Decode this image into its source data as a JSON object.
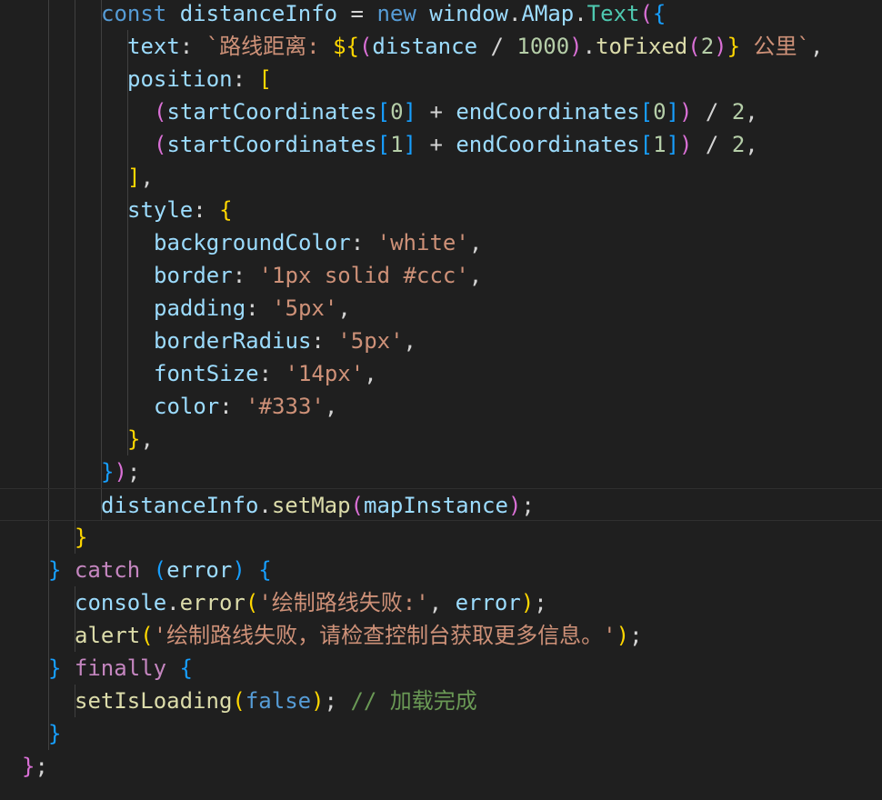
{
  "editor": {
    "language": "javascript",
    "theme": {
      "background": "#1f1f1f",
      "keyword": "#569cd6",
      "control_keyword": "#c586c0",
      "variable": "#9cdcfe",
      "function": "#dcdcaa",
      "class": "#4ec9b0",
      "string": "#ce9178",
      "number": "#b5cea8",
      "comment": "#6a9955",
      "bracket_level_1": "#ffd700",
      "bracket_level_2": "#da70d6",
      "bracket_level_3": "#179fff"
    },
    "lines": [
      {
        "indent": 4,
        "tokens": [
          {
            "t": "const",
            "c": "kw"
          },
          {
            "t": " ",
            "c": "pun"
          },
          {
            "t": "distanceInfo",
            "c": "var"
          },
          {
            "t": " = ",
            "c": "pun"
          },
          {
            "t": "new",
            "c": "kw"
          },
          {
            "t": " ",
            "c": "pun"
          },
          {
            "t": "window",
            "c": "var"
          },
          {
            "t": ".",
            "c": "pun"
          },
          {
            "t": "AMap",
            "c": "var"
          },
          {
            "t": ".",
            "c": "pun"
          },
          {
            "t": "Text",
            "c": "cls"
          },
          {
            "t": "(",
            "c": "b2"
          },
          {
            "t": "{",
            "c": "b3"
          }
        ]
      },
      {
        "indent": 5,
        "tokens": [
          {
            "t": "text",
            "c": "var"
          },
          {
            "t": ": ",
            "c": "pun"
          },
          {
            "t": "`路线距离: ",
            "c": "str"
          },
          {
            "t": "${",
            "c": "b1"
          },
          {
            "t": "(",
            "c": "b2"
          },
          {
            "t": "distance",
            "c": "var"
          },
          {
            "t": " / ",
            "c": "pun"
          },
          {
            "t": "1000",
            "c": "num"
          },
          {
            "t": ")",
            "c": "b2"
          },
          {
            "t": ".",
            "c": "pun"
          },
          {
            "t": "toFixed",
            "c": "fn"
          },
          {
            "t": "(",
            "c": "b2"
          },
          {
            "t": "2",
            "c": "num"
          },
          {
            "t": ")",
            "c": "b2"
          },
          {
            "t": "}",
            "c": "b1"
          },
          {
            "t": " 公里`",
            "c": "str"
          },
          {
            "t": ",",
            "c": "pun"
          }
        ]
      },
      {
        "indent": 5,
        "tokens": [
          {
            "t": "position",
            "c": "var"
          },
          {
            "t": ": ",
            "c": "pun"
          },
          {
            "t": "[",
            "c": "b1"
          }
        ]
      },
      {
        "indent": 6,
        "tokens": [
          {
            "t": "(",
            "c": "b2"
          },
          {
            "t": "startCoordinates",
            "c": "var"
          },
          {
            "t": "[",
            "c": "b3"
          },
          {
            "t": "0",
            "c": "num"
          },
          {
            "t": "]",
            "c": "b3"
          },
          {
            "t": " + ",
            "c": "pun"
          },
          {
            "t": "endCoordinates",
            "c": "var"
          },
          {
            "t": "[",
            "c": "b3"
          },
          {
            "t": "0",
            "c": "num"
          },
          {
            "t": "]",
            "c": "b3"
          },
          {
            "t": ")",
            "c": "b2"
          },
          {
            "t": " / ",
            "c": "pun"
          },
          {
            "t": "2",
            "c": "num"
          },
          {
            "t": ",",
            "c": "pun"
          }
        ]
      },
      {
        "indent": 6,
        "tokens": [
          {
            "t": "(",
            "c": "b2"
          },
          {
            "t": "startCoordinates",
            "c": "var"
          },
          {
            "t": "[",
            "c": "b3"
          },
          {
            "t": "1",
            "c": "num"
          },
          {
            "t": "]",
            "c": "b3"
          },
          {
            "t": " + ",
            "c": "pun"
          },
          {
            "t": "endCoordinates",
            "c": "var"
          },
          {
            "t": "[",
            "c": "b3"
          },
          {
            "t": "1",
            "c": "num"
          },
          {
            "t": "]",
            "c": "b3"
          },
          {
            "t": ")",
            "c": "b2"
          },
          {
            "t": " / ",
            "c": "pun"
          },
          {
            "t": "2",
            "c": "num"
          },
          {
            "t": ",",
            "c": "pun"
          }
        ]
      },
      {
        "indent": 5,
        "tokens": [
          {
            "t": "]",
            "c": "b1"
          },
          {
            "t": ",",
            "c": "pun"
          }
        ]
      },
      {
        "indent": 5,
        "tokens": [
          {
            "t": "style",
            "c": "var"
          },
          {
            "t": ": ",
            "c": "pun"
          },
          {
            "t": "{",
            "c": "b1"
          }
        ]
      },
      {
        "indent": 6,
        "tokens": [
          {
            "t": "backgroundColor",
            "c": "var"
          },
          {
            "t": ": ",
            "c": "pun"
          },
          {
            "t": "'white'",
            "c": "str"
          },
          {
            "t": ",",
            "c": "pun"
          }
        ]
      },
      {
        "indent": 6,
        "tokens": [
          {
            "t": "border",
            "c": "var"
          },
          {
            "t": ": ",
            "c": "pun"
          },
          {
            "t": "'1px solid #ccc'",
            "c": "str"
          },
          {
            "t": ",",
            "c": "pun"
          }
        ]
      },
      {
        "indent": 6,
        "tokens": [
          {
            "t": "padding",
            "c": "var"
          },
          {
            "t": ": ",
            "c": "pun"
          },
          {
            "t": "'5px'",
            "c": "str"
          },
          {
            "t": ",",
            "c": "pun"
          }
        ]
      },
      {
        "indent": 6,
        "tokens": [
          {
            "t": "borderRadius",
            "c": "var"
          },
          {
            "t": ": ",
            "c": "pun"
          },
          {
            "t": "'5px'",
            "c": "str"
          },
          {
            "t": ",",
            "c": "pun"
          }
        ]
      },
      {
        "indent": 6,
        "tokens": [
          {
            "t": "fontSize",
            "c": "var"
          },
          {
            "t": ": ",
            "c": "pun"
          },
          {
            "t": "'14px'",
            "c": "str"
          },
          {
            "t": ",",
            "c": "pun"
          }
        ]
      },
      {
        "indent": 6,
        "tokens": [
          {
            "t": "color",
            "c": "var"
          },
          {
            "t": ": ",
            "c": "pun"
          },
          {
            "t": "'#333'",
            "c": "str"
          },
          {
            "t": ",",
            "c": "pun"
          }
        ]
      },
      {
        "indent": 5,
        "tokens": [
          {
            "t": "}",
            "c": "b1"
          },
          {
            "t": ",",
            "c": "pun"
          }
        ]
      },
      {
        "indent": 4,
        "tokens": [
          {
            "t": "}",
            "c": "b3"
          },
          {
            "t": ")",
            "c": "b2"
          },
          {
            "t": ";",
            "c": "pun"
          }
        ]
      },
      {
        "indent": 4,
        "current": true,
        "tokens": [
          {
            "t": "distanceInfo",
            "c": "var"
          },
          {
            "t": ".",
            "c": "pun"
          },
          {
            "t": "setMap",
            "c": "fn"
          },
          {
            "t": "(",
            "c": "b2"
          },
          {
            "t": "mapInstance",
            "c": "var"
          },
          {
            "t": ")",
            "c": "b2"
          },
          {
            "t": ";",
            "c": "pun"
          }
        ]
      },
      {
        "indent": 3,
        "tokens": [
          {
            "t": "}",
            "c": "b1"
          }
        ]
      },
      {
        "indent": 2,
        "tokens": [
          {
            "t": "}",
            "c": "b3"
          },
          {
            "t": " ",
            "c": "pun"
          },
          {
            "t": "catch",
            "c": "ctl"
          },
          {
            "t": " ",
            "c": "pun"
          },
          {
            "t": "(",
            "c": "b3"
          },
          {
            "t": "error",
            "c": "var"
          },
          {
            "t": ")",
            "c": "b3"
          },
          {
            "t": " ",
            "c": "pun"
          },
          {
            "t": "{",
            "c": "b3"
          }
        ]
      },
      {
        "indent": 3,
        "tokens": [
          {
            "t": "console",
            "c": "var"
          },
          {
            "t": ".",
            "c": "pun"
          },
          {
            "t": "error",
            "c": "fn"
          },
          {
            "t": "(",
            "c": "b1"
          },
          {
            "t": "'绘制路线失败:'",
            "c": "str"
          },
          {
            "t": ", ",
            "c": "pun"
          },
          {
            "t": "error",
            "c": "var"
          },
          {
            "t": ")",
            "c": "b1"
          },
          {
            "t": ";",
            "c": "pun"
          }
        ]
      },
      {
        "indent": 3,
        "tokens": [
          {
            "t": "alert",
            "c": "fn"
          },
          {
            "t": "(",
            "c": "b1"
          },
          {
            "t": "'绘制路线失败，请检查控制台获取更多信息。'",
            "c": "str"
          },
          {
            "t": ")",
            "c": "b1"
          },
          {
            "t": ";",
            "c": "pun"
          }
        ]
      },
      {
        "indent": 2,
        "tokens": [
          {
            "t": "}",
            "c": "b3"
          },
          {
            "t": " ",
            "c": "pun"
          },
          {
            "t": "finally",
            "c": "ctl"
          },
          {
            "t": " ",
            "c": "pun"
          },
          {
            "t": "{",
            "c": "b3"
          }
        ]
      },
      {
        "indent": 3,
        "tokens": [
          {
            "t": "setIsLoading",
            "c": "fn"
          },
          {
            "t": "(",
            "c": "b1"
          },
          {
            "t": "false",
            "c": "kw"
          },
          {
            "t": ")",
            "c": "b1"
          },
          {
            "t": ";",
            "c": "pun"
          },
          {
            "t": " ",
            "c": "pun"
          },
          {
            "t": "// 加载完成",
            "c": "cmt"
          }
        ]
      },
      {
        "indent": 2,
        "tokens": [
          {
            "t": "}",
            "c": "b3"
          }
        ]
      },
      {
        "indent": 1,
        "tokens": [
          {
            "t": "}",
            "c": "b2"
          },
          {
            "t": ";",
            "c": "pun"
          }
        ]
      }
    ]
  }
}
